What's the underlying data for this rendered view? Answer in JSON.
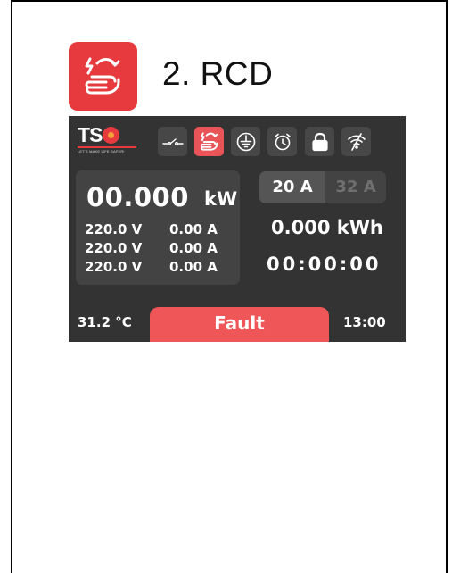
{
  "header": {
    "title": "2. RCD",
    "icon": "rcd-hand-shock-icon",
    "icon_bg_color": "#e63a3e"
  },
  "device": {
    "logo": {
      "text_t": "T",
      "text_s": "S",
      "tagline": "LET'S MAKE LIFE SAFER!"
    },
    "status_icons": [
      {
        "name": "switch-icon",
        "active": false
      },
      {
        "name": "rcd-hand-icon",
        "active": true
      },
      {
        "name": "ground-icon",
        "active": false
      },
      {
        "name": "alarm-clock-icon",
        "active": false
      },
      {
        "name": "lock-icon",
        "active": false
      },
      {
        "name": "wifi-off-icon",
        "active": false
      }
    ],
    "power": {
      "value": "00.000",
      "unit": "kW"
    },
    "phases": [
      {
        "voltage": "220.0 V",
        "current": "0.00 A"
      },
      {
        "voltage": "220.0 V",
        "current": "0.00 A"
      },
      {
        "voltage": "220.0 V",
        "current": "0.00 A"
      }
    ],
    "current_limits": {
      "option_1": "20 A",
      "option_2": "32 A",
      "selected": "20 A"
    },
    "energy": "0.000 kWh",
    "timer": "00:00:00",
    "temperature": "31.2 °C",
    "status": "Fault",
    "status_color": "#ef5657",
    "time": "13:00"
  }
}
